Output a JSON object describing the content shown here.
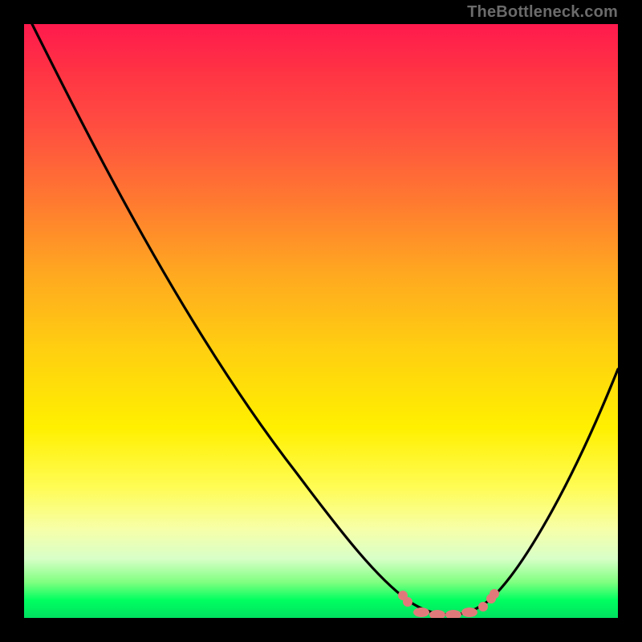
{
  "watermark": "TheBottleneck.com",
  "chart_data": {
    "type": "line",
    "title": "",
    "xlabel": "",
    "ylabel": "",
    "xlim": [
      0,
      100
    ],
    "ylim": [
      0,
      100
    ],
    "x": [
      0,
      5,
      10,
      15,
      20,
      25,
      30,
      35,
      40,
      45,
      50,
      55,
      60,
      62,
      65,
      68,
      70,
      73,
      75,
      78,
      80,
      85,
      90,
      95,
      100
    ],
    "values": [
      100,
      92,
      84,
      76,
      68,
      60,
      52,
      44,
      36,
      28,
      20,
      12,
      6,
      4,
      2,
      1,
      0.5,
      0.3,
      0.5,
      1,
      3,
      10,
      22,
      36,
      52
    ],
    "optimum_range": {
      "x_start": 62,
      "x_end": 80
    },
    "marker_color": "#e07a7a",
    "curve_color": "#000000"
  }
}
